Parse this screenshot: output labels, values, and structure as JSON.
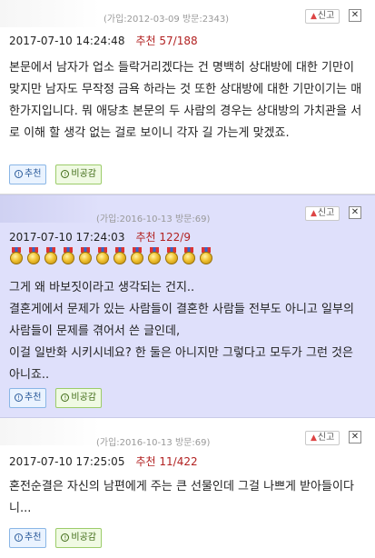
{
  "ui": {
    "report_label": "신고",
    "close_glyph": "✕",
    "recommend_label": "추천",
    "disagree_label": "비공감",
    "recommend_prefix": "추천"
  },
  "comments": [
    {
      "join_info": "(가입:2012-03-09 방문:2343)",
      "datetime": "2017-07-10 14:24:48",
      "recommend": "57/188",
      "medals": 0,
      "text": "본문에서 남자가 업소 들락거리겠다는 건 명백히 상대방에 대한 기만이 맞지만 남자도 무작정 금욕 하라는 것 또한 상대방에 대한 기만이기는 매한가지입니다. 뭐 애당초 본문의 두 사람의 경우는 상대방의 가치관을 서로 이해 할 생각 없는 걸로 보이니 각자 길 가는게 맞겠죠."
    },
    {
      "join_info": "(가입:2016-10-13 방문:69)",
      "datetime": "2017-07-10 17:24:03",
      "recommend": "122/9",
      "medals": 12,
      "text": "그게 왜 바보짓이라고 생각되는 건지..\n결혼게에서 문제가 있는 사람들이 결혼한 사람들 전부도 아니고 일부의 사람들이 문제를 겪어서 쓴 글인데,\n이걸 일반화 시키시네요? 한 둘은 아니지만 그렇다고 모두가 그런 것은 아니죠.."
    },
    {
      "join_info": "(가입:2016-10-13 방문:69)",
      "datetime": "2017-07-10 17:25:05",
      "recommend": "11/422",
      "medals": 0,
      "text": "혼전순결은 자신의 남편에게 주는 큰 선물인데 그걸 나쁘게 받아들이다니..."
    }
  ],
  "colors": {
    "highlight_bg": "#dfe0fb",
    "recommend_red": "#b22222"
  }
}
